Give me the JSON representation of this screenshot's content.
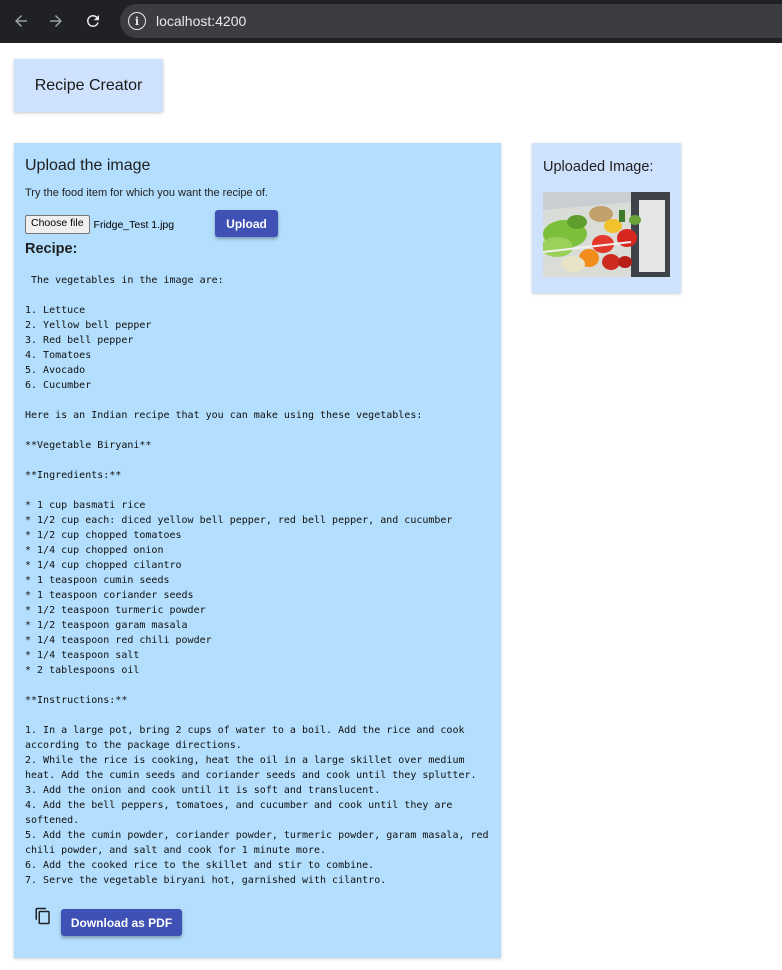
{
  "browser": {
    "url": "localhost:4200",
    "site_info_glyph": "i"
  },
  "header": {
    "title": "Recipe Creator"
  },
  "upload": {
    "heading": "Upload the image",
    "hint": "Try the food item for which you want the recipe of.",
    "choose_file_label": "Choose file",
    "file_name": "Fridge_Test 1.jpg",
    "upload_label": "Upload"
  },
  "recipe": {
    "heading": "Recipe:",
    "text": " The vegetables in the image are:\n\n1. Lettuce\n2. Yellow bell pepper\n3. Red bell pepper\n4. Tomatoes\n5. Avocado\n6. Cucumber\n\nHere is an Indian recipe that you can make using these vegetables:\n\n**Vegetable Biryani**\n\n**Ingredients:**\n\n* 1 cup basmati rice\n* 1/2 cup each: diced yellow bell pepper, red bell pepper, and cucumber\n* 1/2 cup chopped tomatoes\n* 1/4 cup chopped onion\n* 1/4 cup chopped cilantro\n* 1 teaspoon cumin seeds\n* 1 teaspoon coriander seeds\n* 1/2 teaspoon turmeric powder\n* 1/2 teaspoon garam masala\n* 1/4 teaspoon red chili powder\n* 1/4 teaspoon salt\n* 2 tablespoons oil\n\n**Instructions:**\n\n1. In a large pot, bring 2 cups of water to a boil. Add the rice and cook\naccording to the package directions.\n2. While the rice is cooking, heat the oil in a large skillet over medium\nheat. Add the cumin seeds and coriander seeds and cook until they splutter.\n3. Add the onion and cook until it is soft and translucent.\n4. Add the bell peppers, tomatoes, and cucumber and cook until they are\nsoftened.\n5. Add the cumin powder, coriander powder, turmeric powder, garam masala, red\nchili powder, and salt and cook for 1 minute more.\n6. Add the cooked rice to the skillet and stir to combine.\n7. Serve the vegetable biryani hot, garnished with cilantro.",
    "download_label": "Download as PDF"
  },
  "uploaded_image": {
    "heading": "Uploaded Image:"
  },
  "colors": {
    "accent": "#3f51b5",
    "card_light": "#cfe2fd",
    "card_main": "#b3defd",
    "chrome": "#202124"
  },
  "icons": [
    "back-arrow-icon",
    "forward-arrow-icon",
    "reload-icon",
    "info-icon",
    "copy-icon"
  ]
}
